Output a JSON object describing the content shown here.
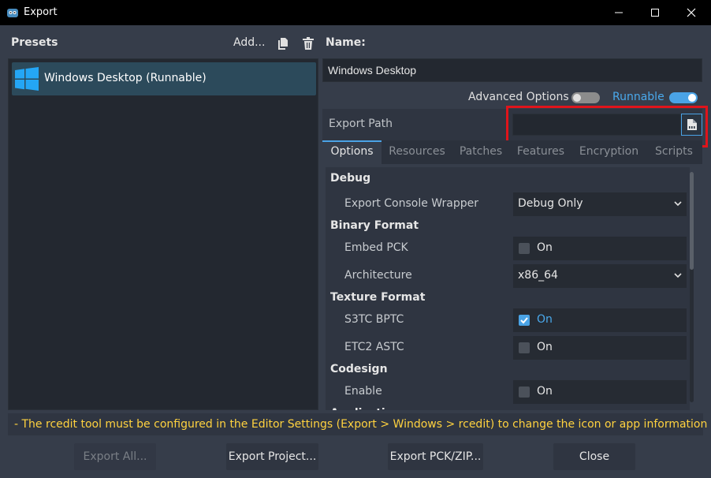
{
  "window": {
    "title": "Export",
    "minimize_icon": "minimize-icon",
    "maximize_icon": "maximize-icon",
    "close_icon": "close-icon"
  },
  "presets": {
    "label": "Presets",
    "add_label": "Add...",
    "items": [
      {
        "label": "Windows Desktop (Runnable)",
        "icon": "windows-logo-icon",
        "selected": true
      }
    ]
  },
  "details": {
    "name_label": "Name:",
    "name_value": "Windows Desktop",
    "advanced_options_label": "Advanced Options",
    "advanced_options_on": false,
    "runnable_label": "Runnable",
    "runnable_on": true,
    "export_path_label": "Export Path",
    "export_path_value": ""
  },
  "tabs": [
    {
      "label": "Options",
      "active": true
    },
    {
      "label": "Resources",
      "active": false
    },
    {
      "label": "Patches",
      "active": false
    },
    {
      "label": "Features",
      "active": false
    },
    {
      "label": "Encryption",
      "active": false
    },
    {
      "label": "Scripts",
      "active": false
    }
  ],
  "options": {
    "debug_section": "Debug",
    "export_console_wrapper_label": "Export Console Wrapper",
    "export_console_wrapper_value": "Debug Only",
    "binary_format_section": "Binary Format",
    "embed_pck_label": "Embed PCK",
    "embed_pck_value": "On",
    "embed_pck_checked": false,
    "architecture_label": "Architecture",
    "architecture_value": "x86_64",
    "texture_format_section": "Texture Format",
    "s3tc_bptc_label": "S3TC BPTC",
    "s3tc_bptc_value": "On",
    "s3tc_bptc_checked": true,
    "etc2_astc_label": "ETC2 ASTC",
    "etc2_astc_value": "On",
    "etc2_astc_checked": false,
    "codesign_section": "Codesign",
    "enable_label": "Enable",
    "enable_value": "On",
    "enable_checked": false,
    "application_section": "Application"
  },
  "warning": "- The rcedit tool must be configured in the Editor Settings (Export > Windows > rcedit) to change the icon or app information data.",
  "buttons": {
    "export_all": "Export All...",
    "export_project": "Export Project...",
    "export_pck_zip": "Export PCK/ZIP...",
    "close": "Close"
  },
  "colors": {
    "accent": "#4aa3e6",
    "warning": "#ffd23f",
    "highlight": "#e0141b"
  }
}
